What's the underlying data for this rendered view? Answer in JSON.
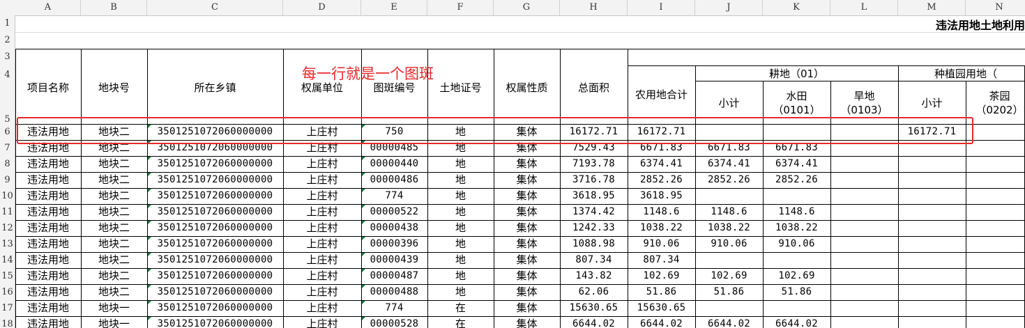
{
  "column_letters": [
    "A",
    "B",
    "C",
    "D",
    "E",
    "F",
    "G",
    "H",
    "I",
    "J",
    "K",
    "L",
    "M",
    "N"
  ],
  "row_numbers": [
    "1",
    "2",
    "3",
    "4",
    "5",
    "6",
    "7",
    "8",
    "9",
    "10",
    "11",
    "12",
    "13",
    "14",
    "15",
    "16",
    "17",
    "18"
  ],
  "title": "违法用地土地利用",
  "annotation": "每一行就是一个图斑",
  "headers": {
    "project_name": "项目名称",
    "plot_no": "地块号",
    "town": "所在乡镇",
    "owner_unit": "权属单位",
    "patch_no": "图斑编号",
    "land_cert": "土地证号",
    "ownership_type": "权属性质",
    "total_area": "总面积",
    "agri_total": "农用地合计",
    "cultivated": "耕地（01）",
    "cult_subtotal": "小计",
    "paddy": "水田",
    "paddy_code": "（0101）",
    "dry": "旱地",
    "dry_code": "（0103）",
    "plantation": "种植园用地（",
    "plant_subtotal": "小计",
    "tea": "茶园",
    "tea_code": "（0202）"
  },
  "rows": [
    {
      "a": "违法用地",
      "b": "地块二",
      "c": "3501251072060000000",
      "d": "上庄村",
      "e": "750",
      "f": "地",
      "g": "集体",
      "h": "16172.71",
      "i": "16172.71",
      "j": "",
      "k": "",
      "l": "",
      "m": "16172.71",
      "n": ""
    },
    {
      "a": "违法用地",
      "b": "地块二",
      "c": "3501251072060000000",
      "d": "上庄村",
      "e": "00000485",
      "f": "地",
      "g": "集体",
      "h": "7529.43",
      "i": "6671.83",
      "j": "6671.83",
      "k": "6671.83",
      "l": "",
      "m": "",
      "n": ""
    },
    {
      "a": "违法用地",
      "b": "地块二",
      "c": "3501251072060000000",
      "d": "上庄村",
      "e": "00000440",
      "f": "地",
      "g": "集体",
      "h": "7193.78",
      "i": "6374.41",
      "j": "6374.41",
      "k": "6374.41",
      "l": "",
      "m": "",
      "n": ""
    },
    {
      "a": "违法用地",
      "b": "地块二",
      "c": "3501251072060000000",
      "d": "上庄村",
      "e": "00000486",
      "f": "地",
      "g": "集体",
      "h": "3716.78",
      "i": "2852.26",
      "j": "2852.26",
      "k": "2852.26",
      "l": "",
      "m": "",
      "n": ""
    },
    {
      "a": "违法用地",
      "b": "地块二",
      "c": "3501251072060000000",
      "d": "上庄村",
      "e": "774",
      "f": "地",
      "g": "集体",
      "h": "3618.95",
      "i": "3618.95",
      "j": "",
      "k": "",
      "l": "",
      "m": "",
      "n": ""
    },
    {
      "a": "违法用地",
      "b": "地块二",
      "c": "3501251072060000000",
      "d": "上庄村",
      "e": "00000522",
      "f": "地",
      "g": "集体",
      "h": "1374.42",
      "i": "1148.6",
      "j": "1148.6",
      "k": "1148.6",
      "l": "",
      "m": "",
      "n": ""
    },
    {
      "a": "违法用地",
      "b": "地块二",
      "c": "3501251072060000000",
      "d": "上庄村",
      "e": "00000438",
      "f": "地",
      "g": "集体",
      "h": "1242.33",
      "i": "1038.22",
      "j": "1038.22",
      "k": "1038.22",
      "l": "",
      "m": "",
      "n": ""
    },
    {
      "a": "违法用地",
      "b": "地块二",
      "c": "3501251072060000000",
      "d": "上庄村",
      "e": "00000396",
      "f": "地",
      "g": "集体",
      "h": "1088.98",
      "i": "910.06",
      "j": "910.06",
      "k": "910.06",
      "l": "",
      "m": "",
      "n": ""
    },
    {
      "a": "违法用地",
      "b": "地块二",
      "c": "3501251072060000000",
      "d": "上庄村",
      "e": "00000439",
      "f": "地",
      "g": "集体",
      "h": "807.34",
      "i": "807.34",
      "j": "",
      "k": "",
      "l": "",
      "m": "",
      "n": ""
    },
    {
      "a": "违法用地",
      "b": "地块二",
      "c": "3501251072060000000",
      "d": "上庄村",
      "e": "00000487",
      "f": "地",
      "g": "集体",
      "h": "143.82",
      "i": "102.69",
      "j": "102.69",
      "k": "102.69",
      "l": "",
      "m": "",
      "n": ""
    },
    {
      "a": "违法用地",
      "b": "地块二",
      "c": "3501251072060000000",
      "d": "上庄村",
      "e": "00000488",
      "f": "地",
      "g": "集体",
      "h": "62.06",
      "i": "51.86",
      "j": "51.86",
      "k": "51.86",
      "l": "",
      "m": "",
      "n": ""
    },
    {
      "a": "违法用地",
      "b": "地块一",
      "c": "3501251072060000000",
      "d": "上庄村",
      "e": "774",
      "f": "在",
      "g": "集体",
      "h": "15630.65",
      "i": "15630.65",
      "j": "",
      "k": "",
      "l": "",
      "m": "",
      "n": ""
    },
    {
      "a": "违法用地",
      "b": "地块一",
      "c": "3501251072060000000",
      "d": "上庄村",
      "e": "00000528",
      "f": "在",
      "g": "集体",
      "h": "6644.02",
      "i": "6644.02",
      "j": "6644.02",
      "k": "6644.02",
      "l": "",
      "m": "",
      "n": ""
    }
  ],
  "colors": {
    "annotation": "#e8272a",
    "grid": "#000000",
    "header_bg": "#f3f3f3"
  }
}
